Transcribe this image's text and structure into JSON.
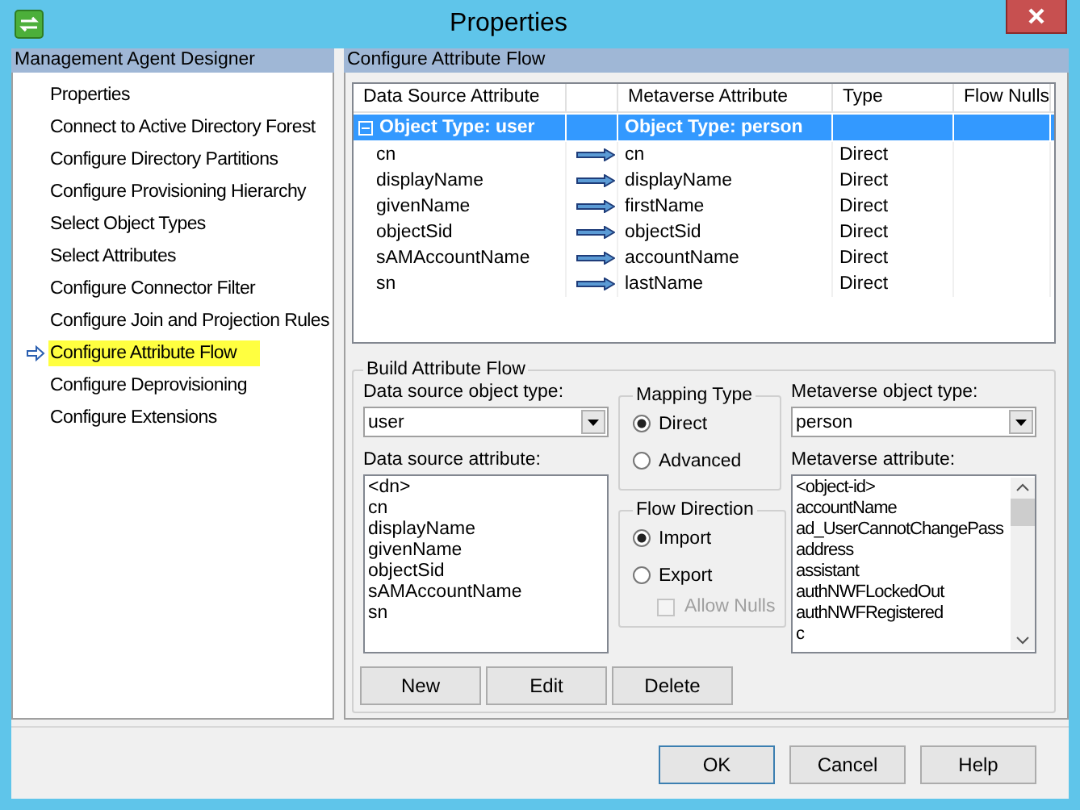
{
  "window": {
    "title": "Properties"
  },
  "sidebar": {
    "title": "Management Agent Designer",
    "items": [
      {
        "label": "Properties",
        "selected": false
      },
      {
        "label": "Connect to Active Directory Forest",
        "selected": false
      },
      {
        "label": "Configure Directory Partitions",
        "selected": false
      },
      {
        "label": "Configure Provisioning Hierarchy",
        "selected": false
      },
      {
        "label": "Select Object Types",
        "selected": false
      },
      {
        "label": "Select Attributes",
        "selected": false
      },
      {
        "label": "Configure Connector Filter",
        "selected": false
      },
      {
        "label": "Configure Join and Projection Rules",
        "selected": false
      },
      {
        "label": "Configure Attribute Flow",
        "selected": true
      },
      {
        "label": "Configure Deprovisioning",
        "selected": false
      },
      {
        "label": "Configure Extensions",
        "selected": false
      }
    ]
  },
  "panel": {
    "title": "Configure Attribute Flow",
    "table": {
      "columns": [
        "Data Source Attribute",
        "Metaverse Attribute",
        "Type",
        "Flow Nulls"
      ],
      "group": {
        "source": "Object Type: user",
        "metaverse": "Object Type: person",
        "expanded": true,
        "selected": true
      },
      "rows": [
        {
          "source": "cn",
          "metaverse": "cn",
          "type": "Direct"
        },
        {
          "source": "displayName",
          "metaverse": "displayName",
          "type": "Direct"
        },
        {
          "source": "givenName",
          "metaverse": "firstName",
          "type": "Direct"
        },
        {
          "source": "objectSid",
          "metaverse": "objectSid",
          "type": "Direct"
        },
        {
          "source": "sAMAccountName",
          "metaverse": "accountName",
          "type": "Direct"
        },
        {
          "source": "sn",
          "metaverse": "lastName",
          "type": "Direct"
        }
      ]
    },
    "build": {
      "title": "Build Attribute Flow",
      "source_object_type": {
        "label": "Data source object type:",
        "value": "user"
      },
      "source_attribute": {
        "label": "Data source attribute:",
        "items": [
          "<dn>",
          "cn",
          "displayName",
          "givenName",
          "objectSid",
          "sAMAccountName",
          "sn"
        ]
      },
      "mapping_type": {
        "title": "Mapping Type",
        "options": [
          {
            "label": "Direct",
            "selected": true
          },
          {
            "label": "Advanced",
            "selected": false
          }
        ]
      },
      "flow_direction": {
        "title": "Flow Direction",
        "options": [
          {
            "label": "Import",
            "selected": true
          },
          {
            "label": "Export",
            "selected": false
          }
        ],
        "allow_nulls": {
          "label": "Allow Nulls",
          "checked": false,
          "disabled": true
        }
      },
      "metaverse_object_type": {
        "label": "Metaverse object type:",
        "value": "person"
      },
      "metaverse_attribute": {
        "label": "Metaverse attribute:",
        "items": [
          "<object-id>",
          "accountName",
          "ad_UserCannotChangePass",
          "address",
          "assistant",
          "authNWFLockedOut",
          "authNWFRegistered",
          "c"
        ]
      },
      "buttons": [
        "New",
        "Edit",
        "Delete"
      ]
    }
  },
  "buttons": [
    "OK",
    "Cancel",
    "Help"
  ]
}
